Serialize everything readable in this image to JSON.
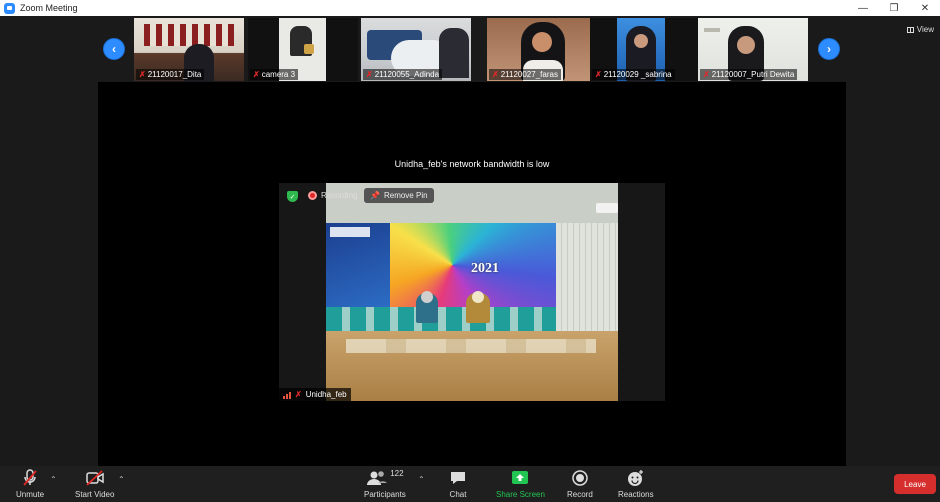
{
  "window": {
    "title": "Zoom Meeting"
  },
  "view_label": "View",
  "thumbnails": [
    {
      "name": "21120017_Dita"
    },
    {
      "name": "camera 3"
    },
    {
      "name": "21120055_Adinda"
    },
    {
      "name": "21120027_faras"
    },
    {
      "name": "21120029 _sabrina"
    },
    {
      "name": "21120007_Putri Dewita"
    }
  ],
  "stage": {
    "bandwidth_notice": "Unidha_feb's network bandwidth is low",
    "recording_label": "Recording",
    "remove_pin_label": "Remove Pin",
    "pinned_name": "Unidha_feb",
    "banner_year": "2021"
  },
  "toolbar": {
    "unmute": "Unmute",
    "start_video": "Start Video",
    "participants": "Participants",
    "participants_count": "122",
    "chat": "Chat",
    "share_screen": "Share Screen",
    "record": "Record",
    "reactions": "Reactions",
    "leave": "Leave"
  },
  "colors": {
    "accent": "#2d8cff",
    "share_green": "#23c552",
    "leave_red": "#d62d2d",
    "muted_red": "#e02828"
  }
}
